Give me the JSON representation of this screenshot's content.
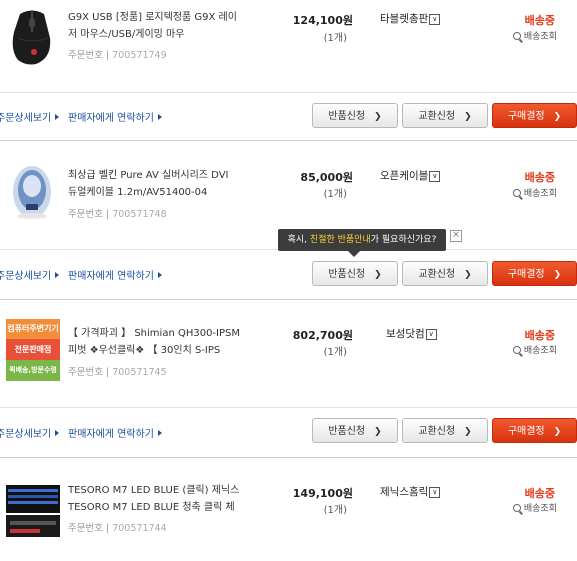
{
  "common": {
    "detail_link": "주문상세보기",
    "contact_link": "판매자에게 연락하기",
    "return_btn": "반품신청",
    "exchange_btn": "교환신청",
    "confirm_btn": "구매결정",
    "order_no_label": "주문번호",
    "status": "배송중",
    "tracking": "배송조회",
    "arrow": "❯"
  },
  "orders": [
    {
      "name_line1": "G9X USB [정품] 로지텍정품 G9X 레이",
      "name_line2": "저 마우스/USB/게이밍 마우",
      "order_no": "700571749",
      "price": "124,100원",
      "qty": "(1개)",
      "seller": "타블렛총판"
    },
    {
      "name_line1": "최상급 벨킨 Pure AV 실버시리즈 DVI",
      "name_line2": "듀얼케이블 1.2m/AV51400-04",
      "order_no": "700571748",
      "price": "85,000원",
      "qty": "(1개)",
      "seller": "오픈케이블"
    },
    {
      "name_line1": "【 가격파괴 】 Shimian QH300-IPSM",
      "name_line2": "피벗 ❖우선클릭❖ 【 30인치 S-IPS",
      "order_no": "700571745",
      "price": "802,700원",
      "qty": "(1개)",
      "seller": "보성닷컴"
    },
    {
      "name_line1": "TESORO M7 LED BLUE (클릭) 제닉스",
      "name_line2": "TESORO M7 LED BLUE 청축 클릭 체",
      "order_no": "700571744",
      "price": "149,100원",
      "qty": "(1개)",
      "seller": "제닉스홈릭"
    }
  ],
  "thumb3_text": [
    "컴퓨터주변기기",
    "전문판매점",
    "퀵배송,방문수령"
  ],
  "tooltip": {
    "pre": "혹시, ",
    "highlight": "친절한 반품안내",
    "post": "가 필요하신가요?",
    "close": "×"
  },
  "dropdown_glyph": "∨"
}
